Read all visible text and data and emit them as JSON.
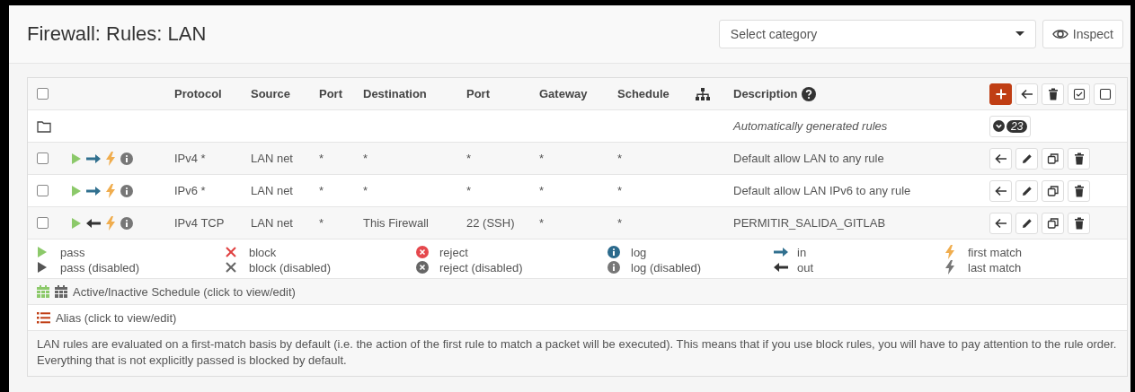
{
  "header": {
    "title": "Firewall: Rules: LAN",
    "category_select": {
      "placeholder": "Select category"
    },
    "inspect_button": "Inspect"
  },
  "table": {
    "select_all": {
      "checked": false
    },
    "columns": [
      "Protocol",
      "Source",
      "Port",
      "Destination",
      "Port",
      "Gateway",
      "Schedule",
      "Description"
    ],
    "group": {
      "description": "Automatically generated rules",
      "count": "23"
    },
    "rules": [
      {
        "checked": false,
        "outbound": false,
        "log": false,
        "protocol": "IPv4 *",
        "source": "LAN net",
        "source_port": "*",
        "destination": "*",
        "destination_port": "*",
        "gateway": "*",
        "schedule": "*",
        "description": "Default allow LAN to any rule"
      },
      {
        "checked": false,
        "outbound": false,
        "log": false,
        "protocol": "IPv6 *",
        "source": "LAN net",
        "source_port": "*",
        "destination": "*",
        "destination_port": "*",
        "gateway": "*",
        "schedule": "*",
        "description": "Default allow LAN IPv6 to any rule"
      },
      {
        "checked": false,
        "outbound": true,
        "log": false,
        "protocol": "IPv4 TCP",
        "source": "LAN net",
        "source_port": "*",
        "destination": "This Firewall",
        "destination_port": "22 (SSH)",
        "gateway": "*",
        "schedule": "*",
        "description": "PERMITIR_SALIDA_GITLAB"
      }
    ],
    "legend": [
      {
        "kind": "pass",
        "label": "pass"
      },
      {
        "kind": "pass_disabled",
        "label": "pass (disabled)"
      },
      {
        "kind": "block",
        "label": "block"
      },
      {
        "kind": "block_disabled",
        "label": "block (disabled)"
      },
      {
        "kind": "reject",
        "label": "reject"
      },
      {
        "kind": "reject_disabled",
        "label": "reject (disabled)"
      },
      {
        "kind": "log",
        "label": "log"
      },
      {
        "kind": "log_disabled",
        "label": "log (disabled)"
      },
      {
        "kind": "in",
        "label": "in"
      },
      {
        "kind": "out",
        "label": "out"
      },
      {
        "kind": "first_match",
        "label": "first match"
      },
      {
        "kind": "last_match",
        "label": "last match"
      }
    ],
    "schedule_note": "Active/Inactive Schedule (click to view/edit)",
    "alias_note": "Alias (click to view/edit)",
    "footnote": "LAN rules are evaluated on a first-match basis by default (i.e. the action of the first rule to match a packet will be executed). This means that if you use block rules, you will have to pay attention to the rule order. Everything that is not explicitly passed is blocked by default."
  }
}
